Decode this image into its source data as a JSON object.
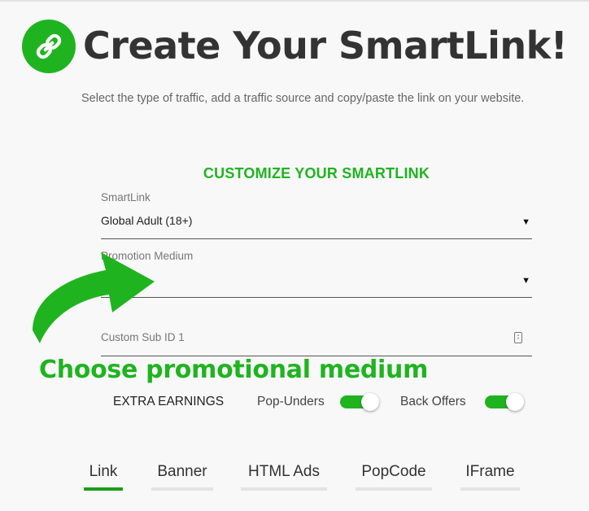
{
  "header": {
    "title": "Create Your SmartLink!",
    "subtitle": "Select the type of traffic, add a traffic source and copy/paste the link on your website.",
    "logo_icon": "link-icon",
    "accent_color": "#1fb41f"
  },
  "form": {
    "section_title": "CUSTOMIZE YOUR SMARTLINK",
    "smartlink": {
      "label": "SmartLink",
      "value": "Global Adult (18+)",
      "caret": "▼"
    },
    "promotion_medium": {
      "label": "Promotion Medium",
      "value": "",
      "caret": "▼"
    },
    "custom_sub_id": {
      "label": "Custom Sub ID 1",
      "value": "",
      "icon": "stepper-icon"
    }
  },
  "annotation": {
    "text": "Choose promotional medium",
    "icon": "curved-arrow-icon"
  },
  "extra_earnings": {
    "label": "EXTRA EARNINGS",
    "toggles": [
      {
        "label": "Pop-Unders",
        "on": true
      },
      {
        "label": "Back Offers",
        "on": true
      }
    ]
  },
  "tabs": [
    {
      "label": "Link",
      "active": true
    },
    {
      "label": "Banner",
      "active": false
    },
    {
      "label": "HTML Ads",
      "active": false
    },
    {
      "label": "PopCode",
      "active": false
    },
    {
      "label": "IFrame",
      "active": false
    }
  ]
}
